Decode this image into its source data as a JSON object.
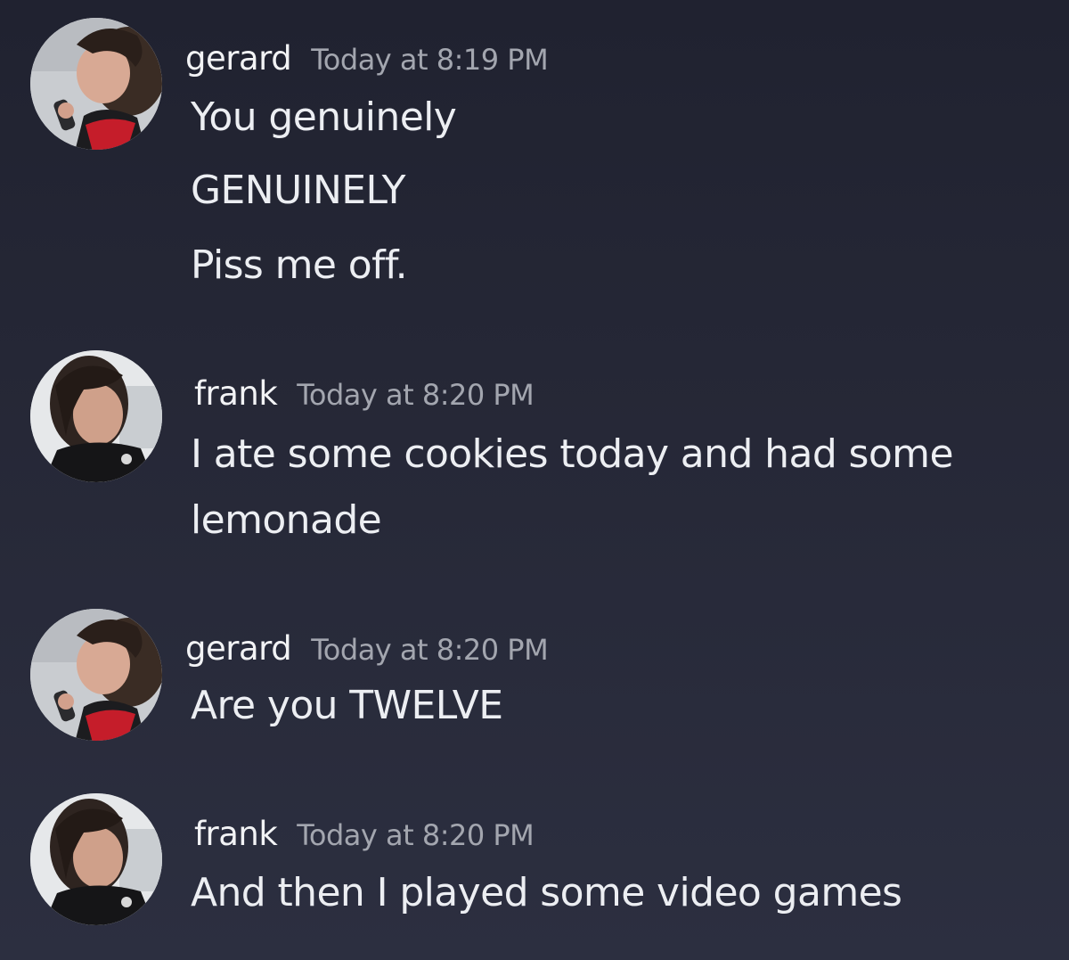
{
  "messages": [
    {
      "username": "gerard",
      "timestamp": "Today at 8:19 PM",
      "avatar_icon": "user-avatar-gerard",
      "lines": [
        "You genuinely",
        "GENUINELY",
        "Piss me off."
      ]
    },
    {
      "username": "frank",
      "timestamp": "Today at 8:20 PM",
      "avatar_icon": "user-avatar-frank",
      "lines": [
        "I ate some cookies today and had some",
        "lemonade"
      ]
    },
    {
      "username": "gerard",
      "timestamp": "Today at 8:20 PM",
      "avatar_icon": "user-avatar-gerard",
      "lines": [
        "Are you TWELVE"
      ]
    },
    {
      "username": "frank",
      "timestamp": "Today at 8:20 PM",
      "avatar_icon": "user-avatar-frank",
      "lines": [
        "And then I played some video games"
      ]
    }
  ],
  "colors": {
    "background": "#262837",
    "username": "#f2f3f5",
    "timestamp": "#a3a6af",
    "message_text": "#eceef2"
  }
}
